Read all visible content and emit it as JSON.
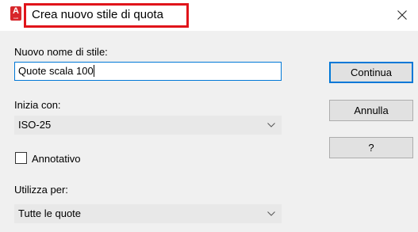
{
  "window": {
    "title": "Crea nuovo stile di quota",
    "app_icon": {
      "letter": "A",
      "sub": "CAD"
    }
  },
  "form": {
    "name_label": "Nuovo nome di stile:",
    "name_value": "Quote scala 100",
    "start_label": "Inizia con:",
    "start_value": "ISO-25",
    "annotative_label": "Annotativo",
    "annotative_checked": false,
    "use_label": "Utilizza per:",
    "use_value": "Tutte le quote"
  },
  "buttons": {
    "continue": "Continua",
    "cancel": "Annulla",
    "help": "?"
  },
  "colors": {
    "highlight": "#e0141a",
    "accent": "#0078d7",
    "app_icon": "#d7262a"
  }
}
